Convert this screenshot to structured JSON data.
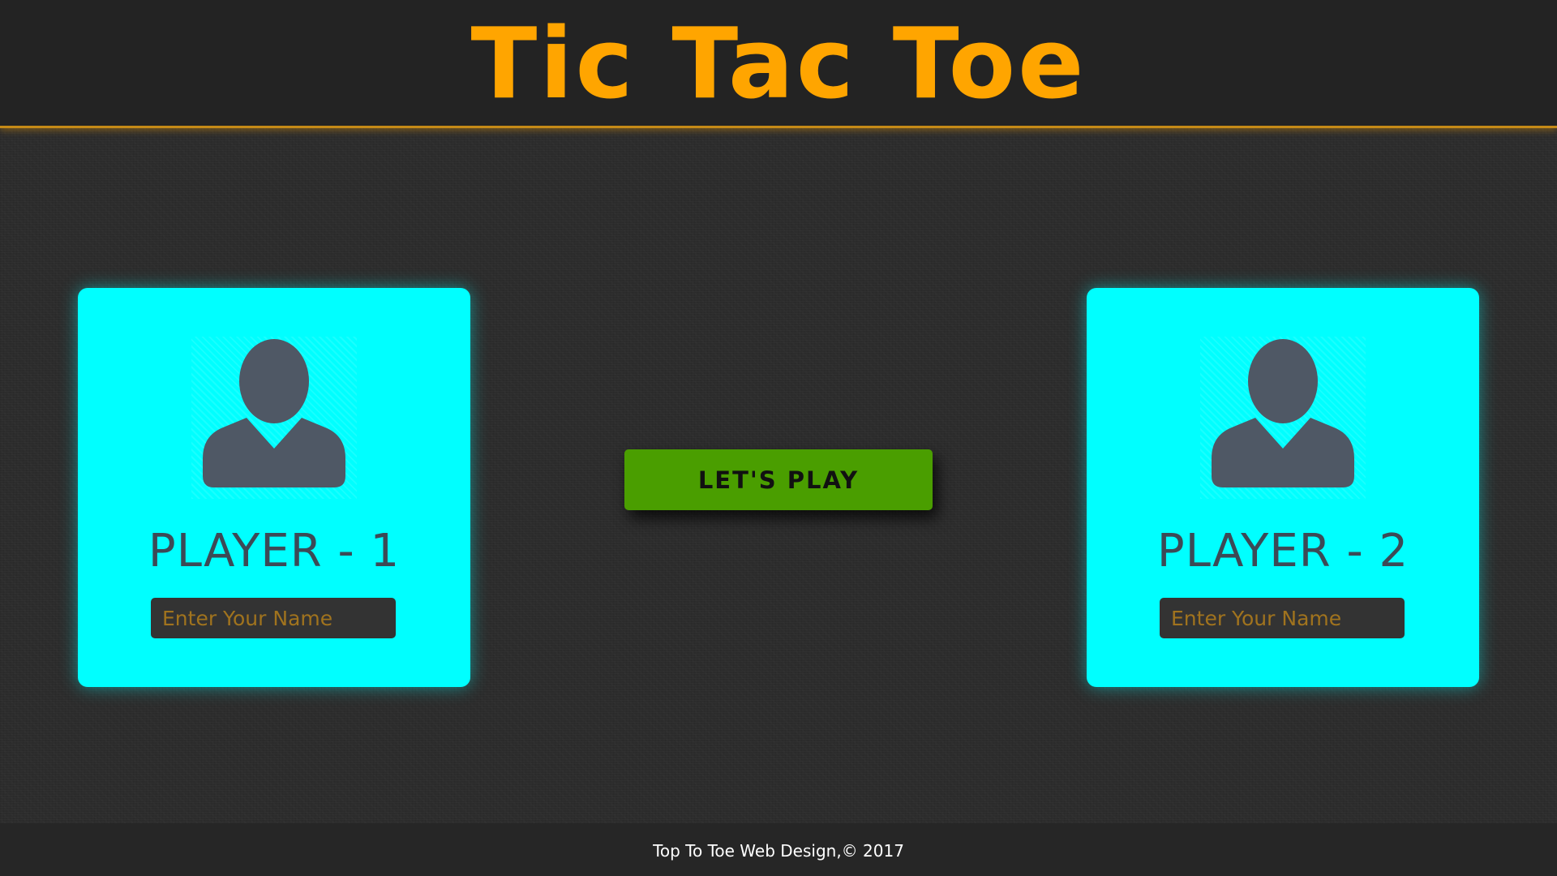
{
  "header": {
    "title": "Tic Tac Toe"
  },
  "players": [
    {
      "label": "PLAYER - 1",
      "name_value": "",
      "name_placeholder": "Enter Your Name",
      "avatar_icon": "user-avatar-icon"
    },
    {
      "label": "PLAYER - 2",
      "name_value": "",
      "name_placeholder": "Enter Your Name",
      "avatar_icon": "user-avatar-icon"
    }
  ],
  "actions": {
    "play_label": "LET'S PLAY"
  },
  "footer": {
    "text": "Top To Toe Web Design,© 2017"
  },
  "colors": {
    "title": "#ffa500",
    "card": "#00ffff",
    "avatar": "#4f5865",
    "play_button": "#4a9e00",
    "input_bg": "#333333",
    "input_text": "#a0731e",
    "label_text": "#3c4a56"
  }
}
